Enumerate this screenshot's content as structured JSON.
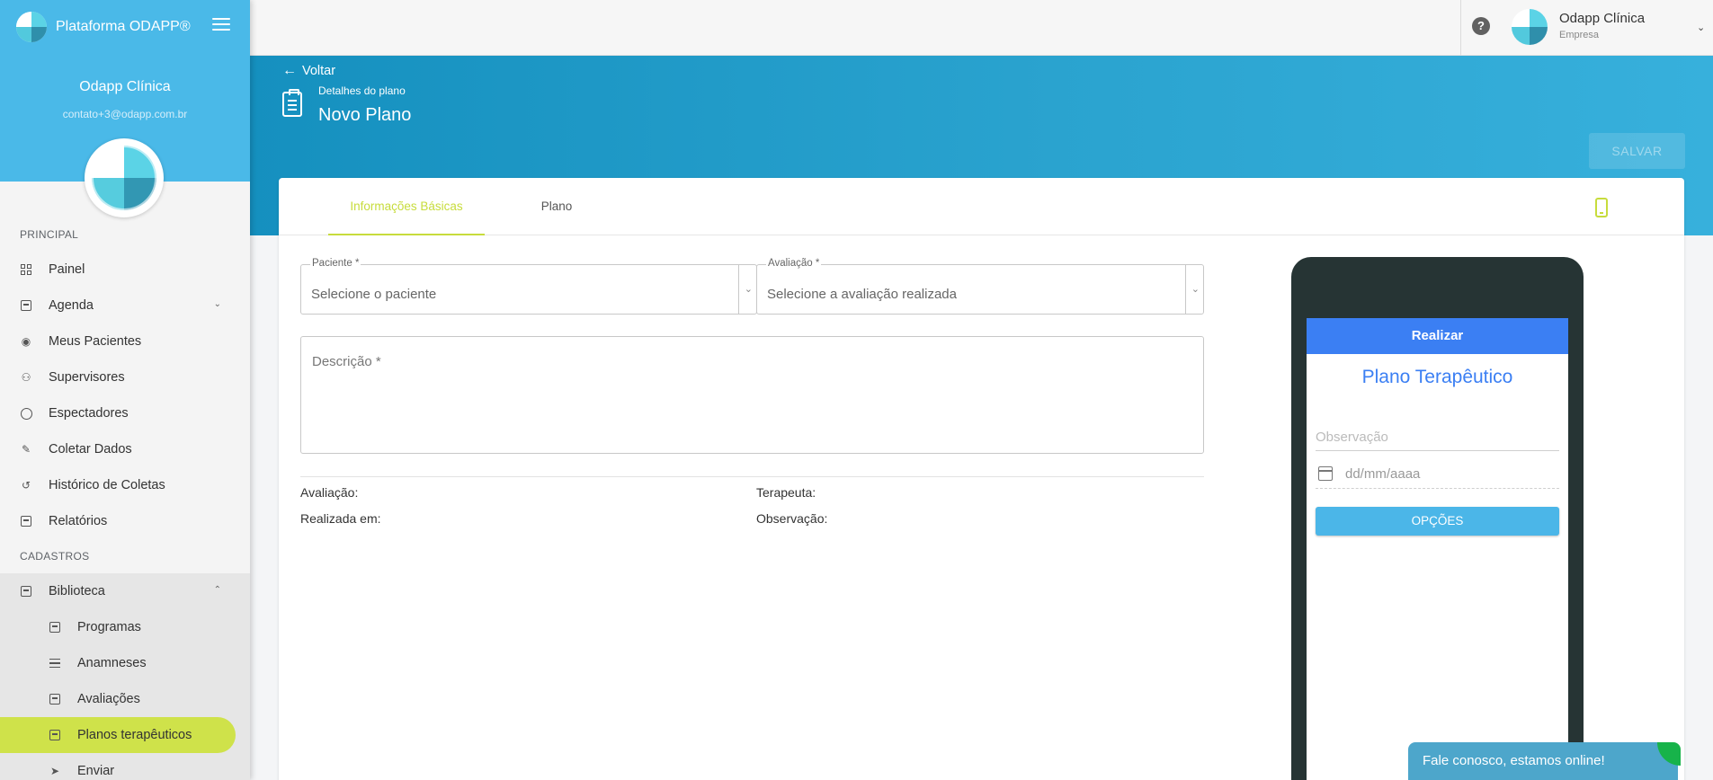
{
  "brand": {
    "name": "Plataforma ODAPP®"
  },
  "sidebar": {
    "user_name": "Odapp Clínica",
    "user_email": "contato+3@odapp.com.br",
    "sections": {
      "principal": "PRINCIPAL",
      "cadastros": "CADASTROS"
    },
    "items": {
      "painel": "Painel",
      "agenda": "Agenda",
      "meus_pacientes": "Meus Pacientes",
      "supervisores": "Supervisores",
      "espectadores": "Espectadores",
      "coletar_dados": "Coletar Dados",
      "historico_coletas": "Histórico de Coletas",
      "relatorios": "Relatórios",
      "biblioteca": "Biblioteca",
      "programas": "Programas",
      "anamneses": "Anamneses",
      "avaliacoes": "Avaliações",
      "planos_terapeuticos": "Planos terapêuticos",
      "enviar": "Enviar"
    }
  },
  "topbar": {
    "help_symbol": "?",
    "org_name": "Odapp Clínica",
    "org_type": "Empresa"
  },
  "header": {
    "back_label": "Voltar",
    "subtitle": "Detalhes do plano",
    "title": "Novo Plano",
    "save_label": "SALVAR"
  },
  "tabs": {
    "basic": "Informações Básicas",
    "plan": "Plano"
  },
  "form": {
    "patient_label": "Paciente *",
    "patient_value": "Selecione o paciente",
    "evaluation_label": "Avaliação *",
    "evaluation_value": "Selecione a avaliação realizada",
    "description_placeholder": "Descrição *"
  },
  "info": {
    "avaliacao": "Avaliação:",
    "terapeuta": "Terapeuta:",
    "realizada_em": "Realizada em:",
    "observacao": "Observação:"
  },
  "phone_preview": {
    "header": "Realizar",
    "title": "Plano Terapêutico",
    "observation_placeholder": "Observação",
    "date_placeholder": "dd/mm/aaaa",
    "options_button": "OPÇÕES"
  },
  "chat": {
    "label": "Fale conosco, estamos online!"
  },
  "colors": {
    "sidebar_header": "#4ab9e8",
    "active_item": "#cfe24a",
    "banner": "#1590bf",
    "accent_tab": "#c7dc3c",
    "phone_header": "#3b7ff3",
    "chat": "#4da6cb"
  }
}
